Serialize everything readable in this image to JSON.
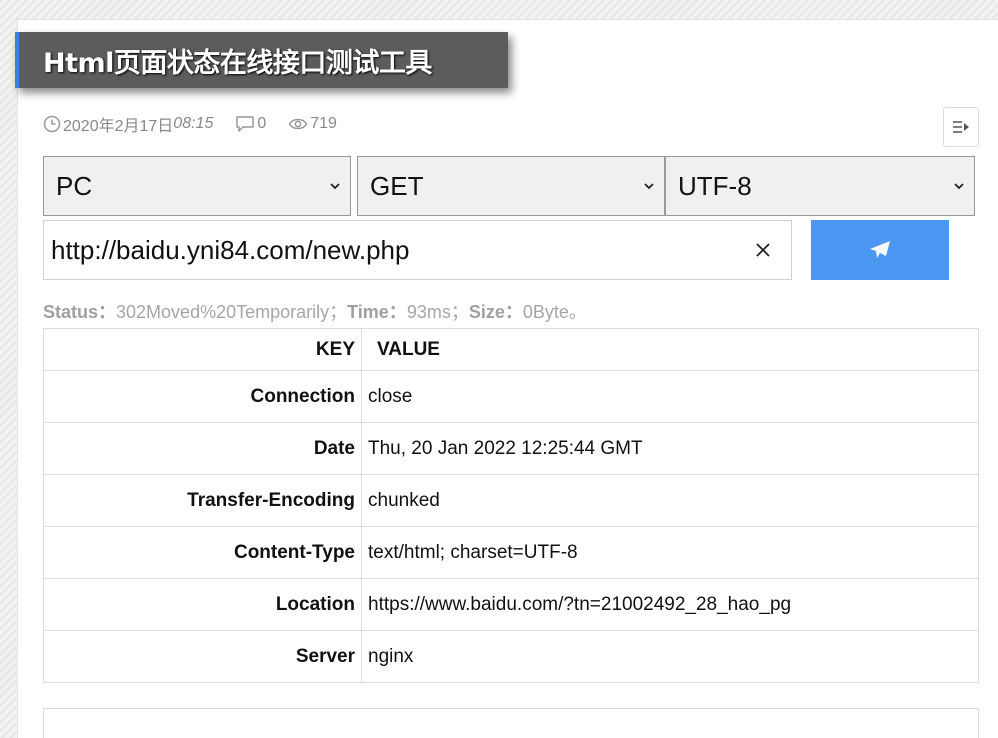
{
  "page": {
    "title": "Html页面状态在线接口测试工具"
  },
  "meta": {
    "date": "2020年2月17日",
    "time": "08:15",
    "comments": "0",
    "views": "719"
  },
  "form": {
    "device_selected": "PC",
    "method_selected": "GET",
    "charset_selected": "UTF-8",
    "url_value": "http://baidu.yni84.com/new.php"
  },
  "status": {
    "status_label": "Status：",
    "status_value": "302Moved%20Temporarily；",
    "time_label": "Time：",
    "time_value": "93ms；",
    "size_label": "Size：",
    "size_value": "0Byte。"
  },
  "table": {
    "key_header": "KEY",
    "value_header": "VALUE",
    "rows": [
      {
        "key": "Connection",
        "value": "close"
      },
      {
        "key": "Date",
        "value": "Thu, 20 Jan 2022 12:25:44 GMT"
      },
      {
        "key": "Transfer-Encoding",
        "value": "chunked"
      },
      {
        "key": "Content-Type",
        "value": "text/html; charset=UTF-8"
      },
      {
        "key": "Location",
        "value": "https://www.baidu.com/?tn=21002492_28_hao_pg"
      },
      {
        "key": "Server",
        "value": "nginx"
      }
    ]
  },
  "icons": {
    "date": "clock-icon",
    "comments": "comment-icon",
    "views": "eye-icon",
    "toggle": "sidebar-toggle-icon",
    "clear": "close-icon",
    "send": "paper-plane-icon",
    "dropdown": "chevron-down-icon"
  },
  "colors": {
    "accent": "#4c97f2",
    "banner": "#5c5c5c",
    "banner_accent": "#3a7fe0"
  }
}
